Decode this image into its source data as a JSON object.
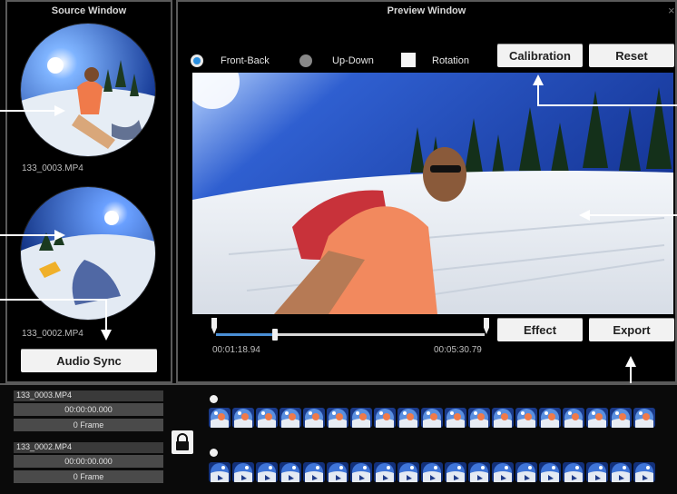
{
  "source_window": {
    "title": "Source Window",
    "clips": [
      {
        "filename": "133_0003.MP4"
      },
      {
        "filename": "133_0002.MP4"
      }
    ],
    "audio_sync_label": "Audio Sync"
  },
  "preview_window": {
    "title": "Preview Window",
    "close_glyph": "×",
    "modes": [
      {
        "label": "Front-Back",
        "selected": true
      },
      {
        "label": "Up-Down",
        "selected": false
      },
      {
        "label": "Rotation",
        "checked": false
      }
    ],
    "calibration_label": "Calibration",
    "reset_label": "Reset",
    "effect_label": "Effect",
    "export_label": "Export",
    "current_time": "00:01:18.94",
    "total_time": "00:05:30.79",
    "playback_progress": 0.22
  },
  "timeline": {
    "tracks": [
      {
        "name": "133_0003.MP4",
        "offset": "00:00:00.000",
        "frame": "0 Frame"
      },
      {
        "name": "133_0002.MP4",
        "offset": "00:00:00.000",
        "frame": "0 Frame"
      }
    ],
    "lock_icon": "lock-icon"
  },
  "colors": {
    "accent": "#2a8fe0",
    "panel_border": "#5a5a5a"
  }
}
